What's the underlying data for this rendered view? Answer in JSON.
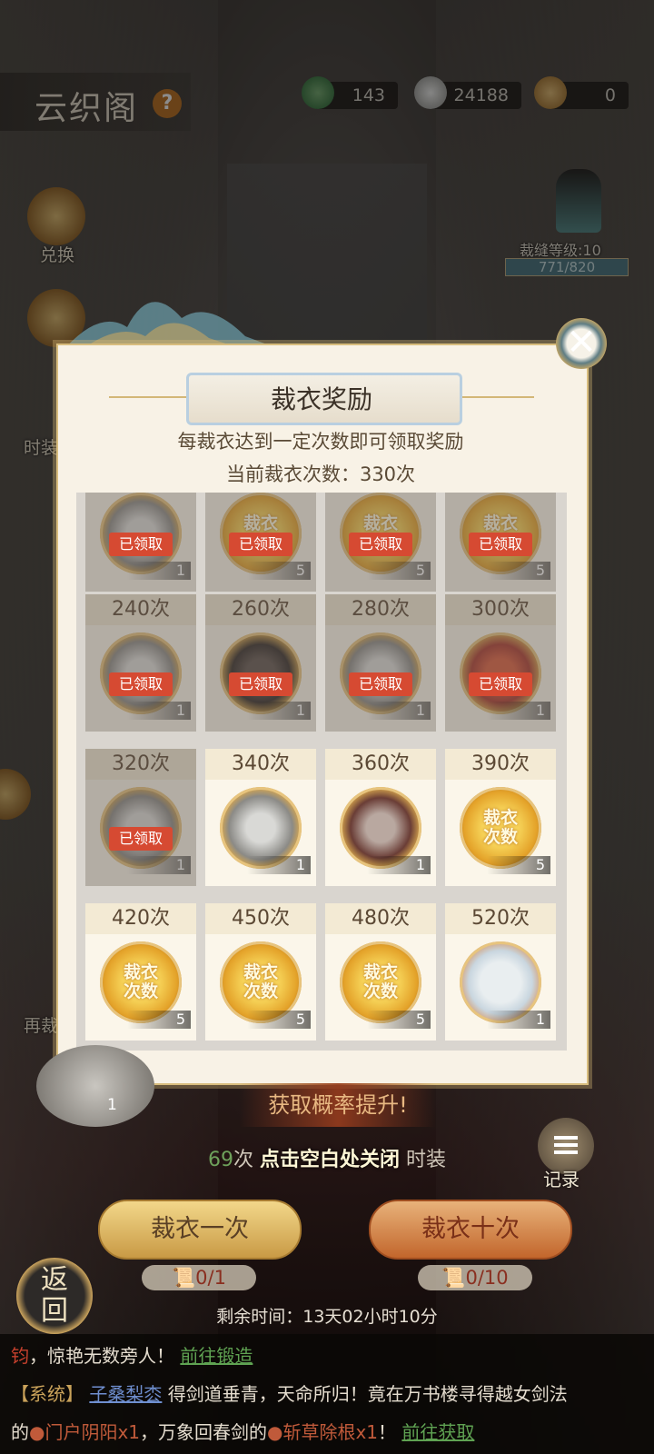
{
  "header": {
    "title": "云织阁",
    "help_icon": "?",
    "resources": [
      {
        "icon": "jade-token-icon",
        "value": "143"
      },
      {
        "icon": "silver-ingot-icon",
        "value": "24188"
      },
      {
        "icon": "scroll-icon",
        "value": "0"
      }
    ]
  },
  "side": {
    "exchange_label": "兑换",
    "fashion_label": "时装",
    "retake_label": "再裁"
  },
  "level": {
    "label": "裁缝等级:10",
    "progress": "771/820",
    "progress_value": 0.94
  },
  "modal": {
    "title": "裁衣奖励",
    "description": "每裁衣达到一定次数即可领取奖励",
    "current_count": "当前裁衣次数：330次",
    "claimed_label": "已领取",
    "token_text_1": "裁衣",
    "token_text_2": "次数",
    "rows": [
      [
        {
          "header": "",
          "qty": "1",
          "claimed": true,
          "icon": "silver"
        },
        {
          "header": "",
          "qty": "5",
          "claimed": true,
          "icon": "gold"
        },
        {
          "header": "",
          "qty": "5",
          "claimed": true,
          "icon": "gold"
        },
        {
          "header": "",
          "qty": "5",
          "claimed": true,
          "icon": "gold"
        }
      ],
      [
        {
          "header": "240次",
          "qty": "1",
          "claimed": true,
          "icon": "silver"
        },
        {
          "header": "260次",
          "qty": "1",
          "claimed": true,
          "icon": "dark"
        },
        {
          "header": "280次",
          "qty": "1",
          "claimed": true,
          "icon": "silver"
        },
        {
          "header": "300次",
          "qty": "1",
          "claimed": true,
          "icon": "red"
        }
      ],
      [
        {
          "header": "320次",
          "qty": "1",
          "claimed": true,
          "icon": "silver"
        },
        {
          "header": "340次",
          "qty": "1",
          "claimed": false,
          "icon": "silver"
        },
        {
          "header": "360次",
          "qty": "1",
          "claimed": false,
          "icon": "scene"
        },
        {
          "header": "390次",
          "qty": "5",
          "claimed": false,
          "icon": "gold"
        }
      ],
      [
        {
          "header": "420次",
          "qty": "5",
          "claimed": false,
          "icon": "gold"
        },
        {
          "header": "450次",
          "qty": "5",
          "claimed": false,
          "icon": "gold"
        },
        {
          "header": "480次",
          "qty": "5",
          "claimed": false,
          "icon": "gold"
        },
        {
          "header": "520次",
          "qty": "1",
          "claimed": false,
          "icon": "pearl"
        }
      ]
    ]
  },
  "bottom": {
    "banner": "获取概率提升!",
    "remaining_count": "69",
    "count_unit": "次",
    "close_hint": "点击空白处关闭",
    "fashion_suffix": "时装",
    "record_label": "记录",
    "tailor_once": "裁衣一次",
    "tailor_ten": "裁衣十次",
    "cost_once": "0/1",
    "cost_ten": "0/10",
    "remaining_time": "剩余时间：13天02小时10分",
    "back_label_1": "返",
    "back_label_2": "回",
    "behind_qty": "1"
  },
  "chat": {
    "line1_red": "钧",
    "line1_text": "，惊艳无数旁人！",
    "line1_link": "前往锻造",
    "line2_sys": "【系统】",
    "line2_player": "子桑梨枩",
    "line2_text": "得剑道垂青，天命所归！竟在万书楼寻得越女剑法",
    "line3_pre": "的",
    "line3_item1": "门户阴阳x1",
    "line3_mid": "，万象回春剑的",
    "line3_item2": "斩草除根x1",
    "line3_end": "！",
    "line3_link": "前往获取"
  },
  "colors": {
    "accent_gold": "#d8bd7e",
    "claimed_red": "#d64a32",
    "link_green": "#5fa252"
  }
}
